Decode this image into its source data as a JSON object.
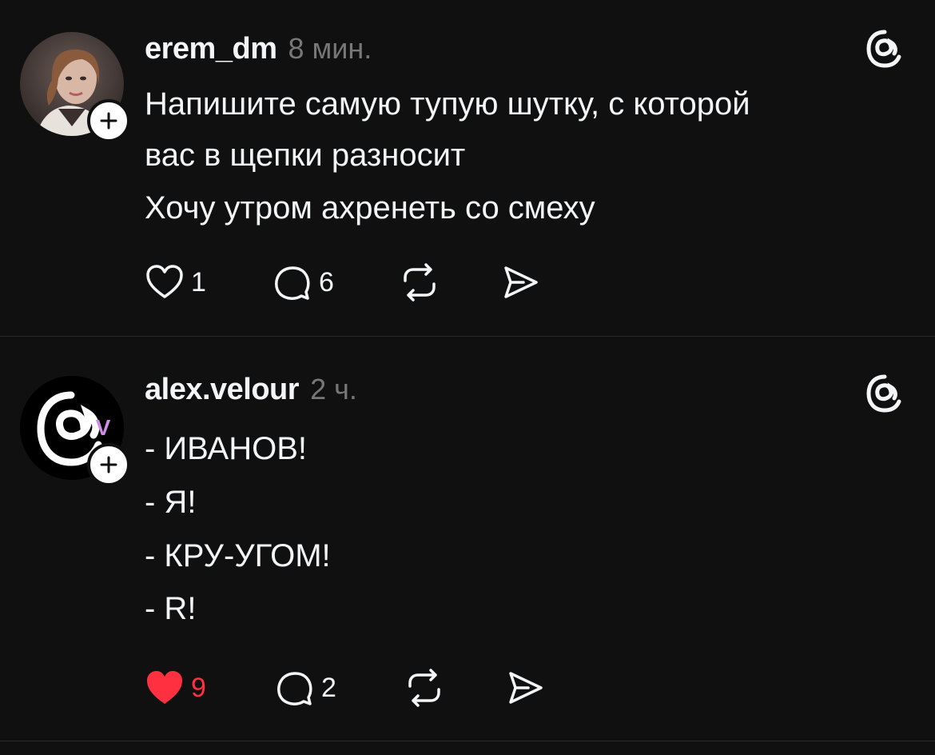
{
  "posts": [
    {
      "username": "erem_dm",
      "time": "8 мин.",
      "lines": [
        "Напишите самую тупую шутку, с которой",
        "вас в щепки разносит",
        "Хочу утром ахренеть со смеху"
      ],
      "likes": "1",
      "liked": false,
      "replies": "6",
      "avatar": "photo-avatar",
      "badge_icon": "plus-icon"
    },
    {
      "username": "alex.velour",
      "time": "2 ч.",
      "lines": [
        "- ИВАНОВ!",
        "- Я!",
        "- КРУ-УГОМ!",
        "- R!"
      ],
      "likes": "9",
      "liked": true,
      "replies": "2",
      "avatar": "threads-logo-avatar",
      "avatar_badge_letter": "V",
      "badge_icon": "plus-icon"
    }
  ],
  "colors": {
    "background": "#101010",
    "text": "#f3f5f7",
    "muted": "#777777",
    "like_red": "#ff3040",
    "avatar_v": "#d08ee8"
  },
  "icons": [
    "heart-icon",
    "comment-icon",
    "repost-icon",
    "share-icon",
    "threads-logo-icon",
    "plus-icon"
  ]
}
